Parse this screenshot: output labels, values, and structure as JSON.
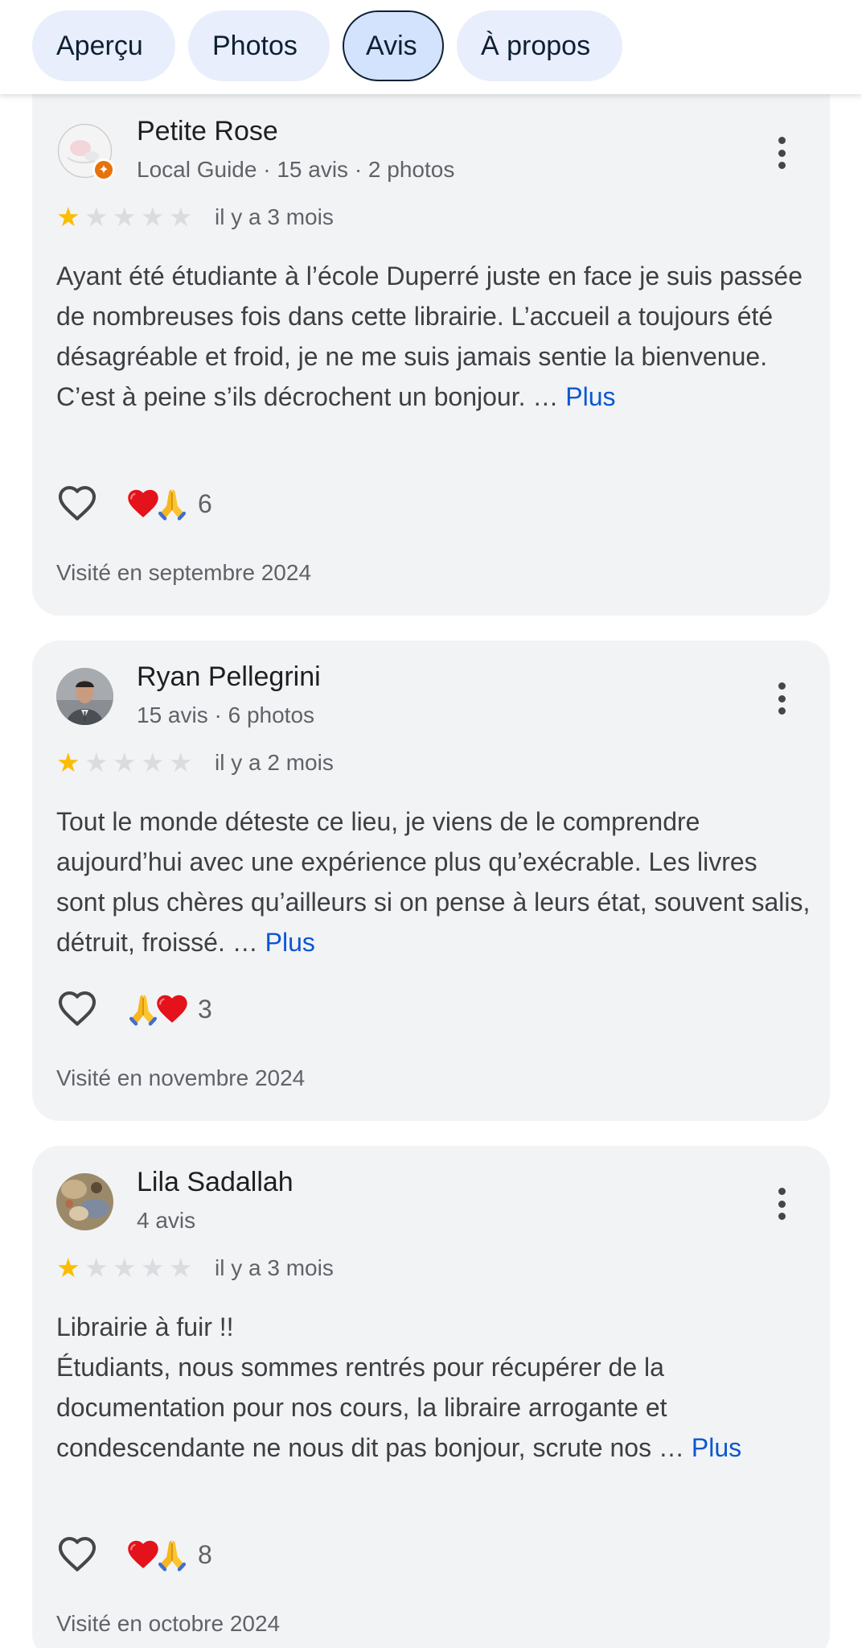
{
  "tabs": [
    {
      "label": "Aperçu",
      "active": false
    },
    {
      "label": "Photos",
      "active": false
    },
    {
      "label": "Avis",
      "active": true
    },
    {
      "label": "À propos",
      "active": false
    }
  ],
  "colors": {
    "accent_link": "#0b57d0",
    "star_filled": "#fbbc04",
    "star_empty": "#dadce0",
    "card_bg": "#f2f3f5",
    "tab_bg": "#e8eefb",
    "tab_active_bg": "#d3e3fd",
    "local_guide_badge": "#e8710a"
  },
  "reviews": [
    {
      "author": "Petite Rose",
      "meta": "Local Guide · 15 avis · 2 photos",
      "local_guide": true,
      "rating": 1,
      "max_rating": 5,
      "date": "il y a 3 mois",
      "text": "Ayant été étudiante à l’école Duperré juste en face je suis passée de nombreuses fois dans cette librairie. L’accueil a toujours été désagréable et froid, je ne me suis jamais sentie la bienvenue. C’est à peine s’ils décrochent un bonjour.",
      "ellipsis": "…",
      "more_label": "Plus",
      "reactions": [
        "heart-emoji",
        "folded-hands-emoji"
      ],
      "reaction_count": "6",
      "visited": "Visité en septembre 2024"
    },
    {
      "author": "Ryan Pellegrini",
      "meta": "15 avis · 6 photos",
      "local_guide": false,
      "rating": 1,
      "max_rating": 5,
      "date": "il y a 2 mois",
      "text": "Tout le monde déteste ce lieu, je viens de le comprendre aujourd’hui avec une expérience plus qu’exécrable. Les livres sont plus chères qu’ailleurs si on pense à leurs état, souvent salis, détruit, froissé.",
      "ellipsis": "…",
      "more_label": "Plus",
      "reactions": [
        "folded-hands-emoji",
        "heart-emoji"
      ],
      "reaction_count": "3",
      "visited": "Visité en novembre 2024"
    },
    {
      "author": "Lila Sadallah",
      "meta": "4 avis",
      "local_guide": false,
      "rating": 1,
      "max_rating": 5,
      "date": "il y a 3 mois",
      "text_line1": "Librairie à fuir !!",
      "text": "Étudiants, nous sommes rentrés pour récupérer de la documentation pour nos cours, la libraire arrogante et condescendante ne nous dit pas bonjour, scrute nos",
      "ellipsis": "…",
      "more_label": "Plus",
      "reactions": [
        "heart-emoji",
        "folded-hands-emoji"
      ],
      "reaction_count": "8",
      "visited": "Visité en octobre 2024"
    }
  ]
}
